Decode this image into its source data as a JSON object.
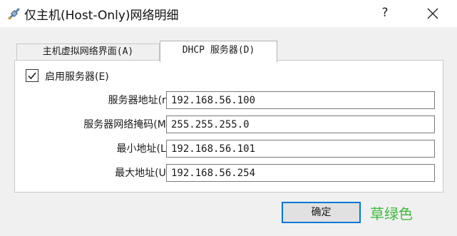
{
  "window": {
    "title": "仅主机(Host-Only)网络明细",
    "help_label": "?"
  },
  "tabs": [
    {
      "label": "主机虚拟网络界面(A)",
      "active": false
    },
    {
      "label": "DHCP 服务器(D)",
      "active": true
    }
  ],
  "dhcp": {
    "enable_checkbox": {
      "label": "启用服务器(E)",
      "checked": true
    },
    "fields": [
      {
        "label": "服务器地址(r):",
        "value": "192.168.56.100"
      },
      {
        "label": "服务器网络掩码(M):",
        "value": "255.255.255.0"
      },
      {
        "label": "最小地址(L):",
        "value": "192.168.56.101"
      },
      {
        "label": "最大地址(U):",
        "value": "192.168.56.254"
      }
    ]
  },
  "buttons": {
    "ok_label": "确定"
  },
  "watermark": "草绿色",
  "colors": {
    "accent": "#0078d7",
    "watermark": "#3dbb3d"
  }
}
